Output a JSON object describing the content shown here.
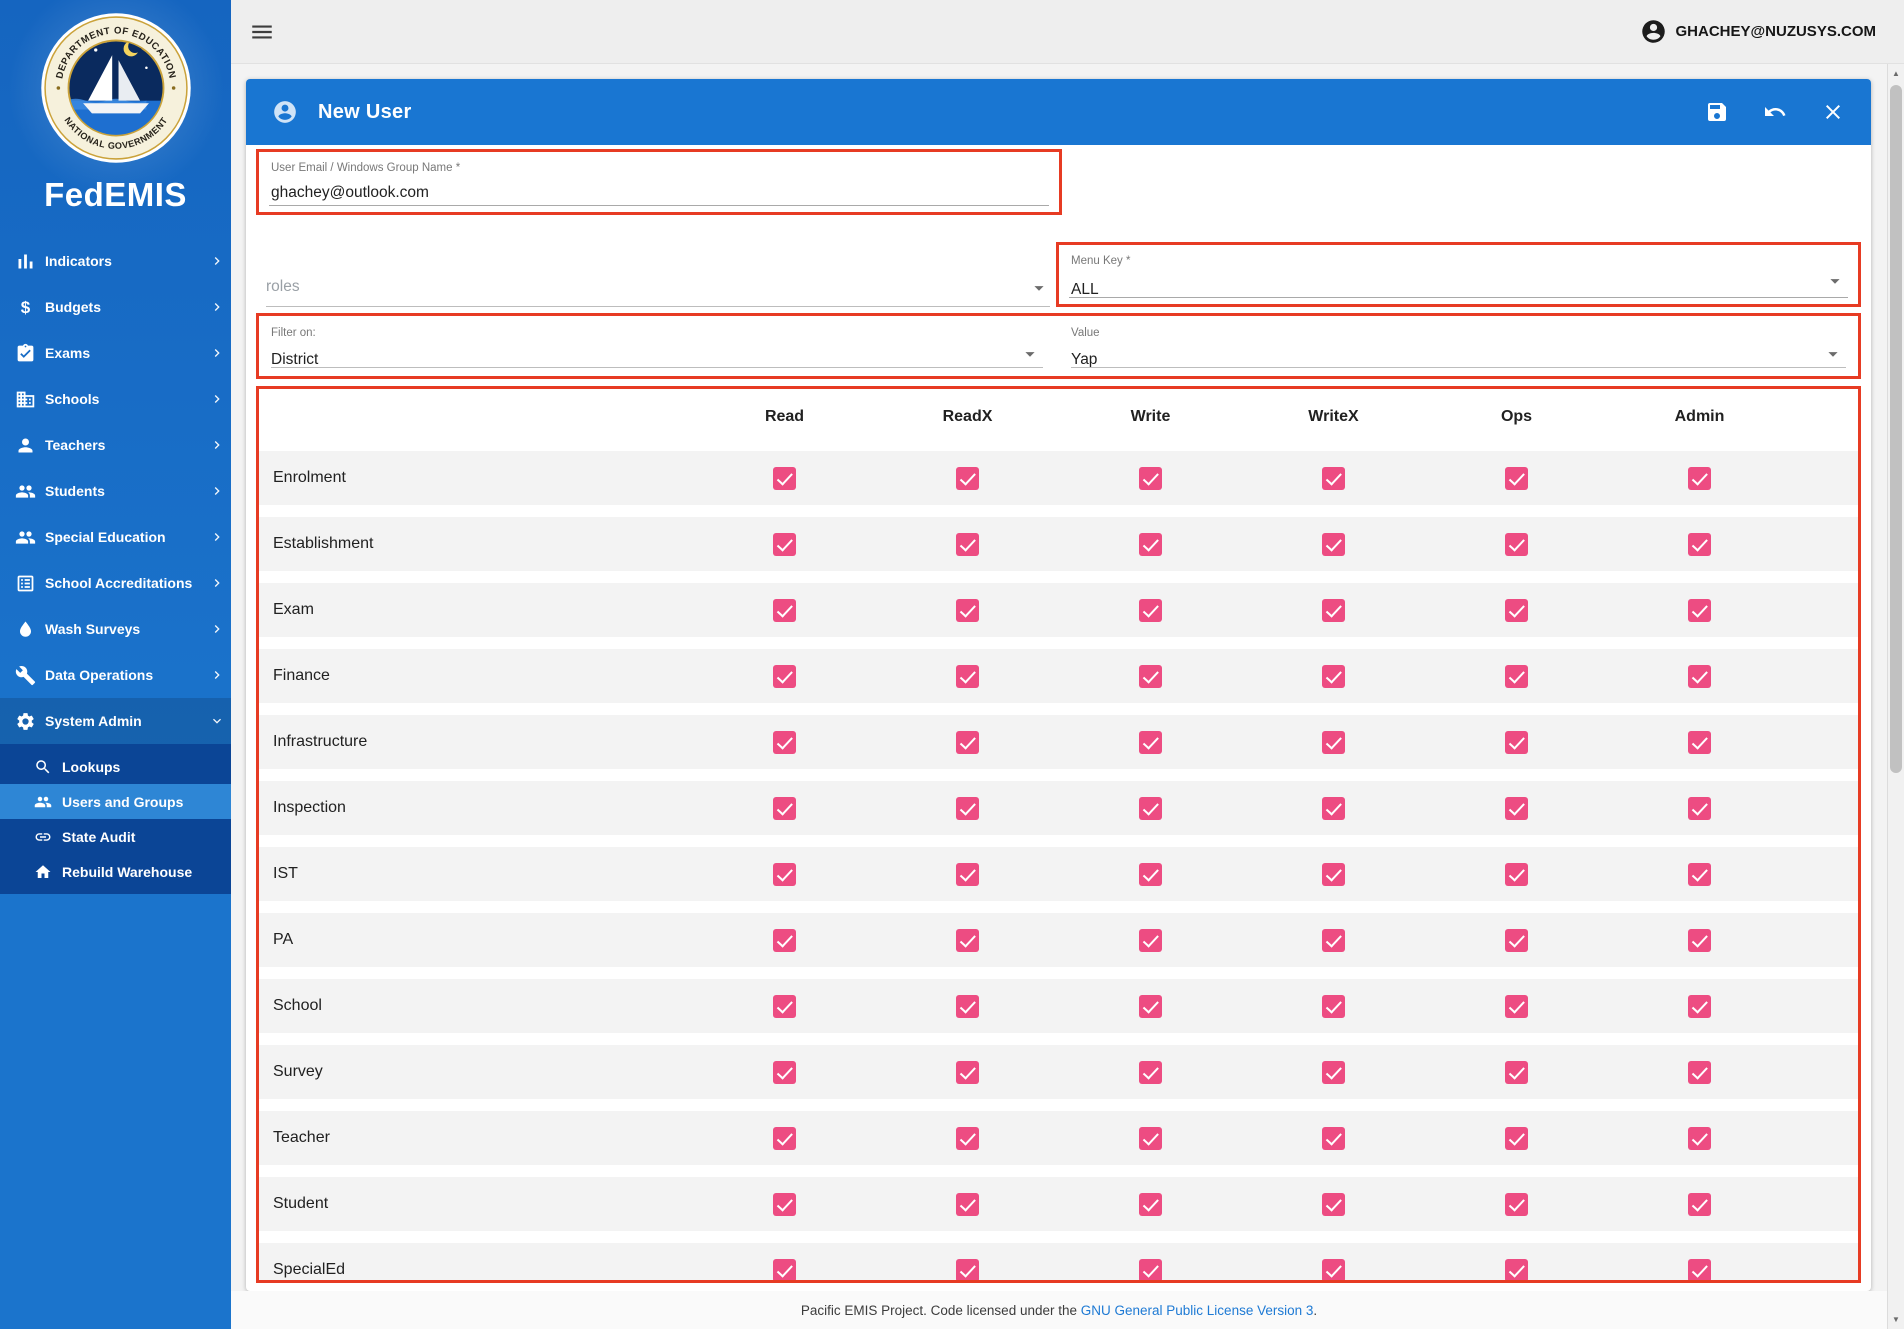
{
  "brand": {
    "title": "FedEMIS",
    "seal_top": "DEPARTMENT OF EDUCATION",
    "seal_bottom": "NATIONAL GOVERNMENT"
  },
  "topbar": {
    "account_email": "GHACHEY@NUZUSYS.COM"
  },
  "icons": {
    "menu": "menu-icon",
    "account": "account-circle-icon",
    "user": "account-circle-icon",
    "save": "save-icon",
    "undo": "undo-icon",
    "close": "close-icon",
    "caret": "caret-down-icon"
  },
  "sidebar": {
    "items": [
      {
        "label": "Indicators",
        "icon": "bar-chart-icon"
      },
      {
        "label": "Budgets",
        "icon": "dollar-icon"
      },
      {
        "label": "Exams",
        "icon": "assignment-icon"
      },
      {
        "label": "Schools",
        "icon": "building-icon"
      },
      {
        "label": "Teachers",
        "icon": "person-icon"
      },
      {
        "label": "Students",
        "icon": "people-icon"
      },
      {
        "label": "Special Education",
        "icon": "people-icon"
      },
      {
        "label": "School Accreditations",
        "icon": "list-card-icon"
      },
      {
        "label": "Wash Surveys",
        "icon": "droplet-icon"
      },
      {
        "label": "Data Operations",
        "icon": "wrench-icon"
      },
      {
        "label": "System Admin",
        "icon": "gear-icon",
        "expanded": true,
        "children": [
          {
            "label": "Lookups",
            "icon": "search-icon"
          },
          {
            "label": "Users and Groups",
            "icon": "people-icon",
            "active": true
          },
          {
            "label": "State Audit",
            "icon": "link-icon"
          },
          {
            "label": "Rebuild Warehouse",
            "icon": "home-icon"
          }
        ]
      }
    ]
  },
  "panel": {
    "title": "New User",
    "email": {
      "label": "User Email / Windows Group Name *",
      "value": "ghachey@outlook.com"
    },
    "roles": {
      "placeholder": "roles"
    },
    "menu_key": {
      "label": "Menu Key *",
      "value": "ALL"
    },
    "filter_on": {
      "label": "Filter on:",
      "value": "District"
    },
    "filter_value": {
      "label": "Value",
      "value": "Yap"
    }
  },
  "permissions": {
    "columns": [
      "Read",
      "ReadX",
      "Write",
      "WriteX",
      "Ops",
      "Admin"
    ],
    "rows": [
      {
        "label": "Enrolment",
        "checks": [
          true,
          true,
          true,
          true,
          true,
          true
        ]
      },
      {
        "label": "Establishment",
        "checks": [
          true,
          true,
          true,
          true,
          true,
          true
        ]
      },
      {
        "label": "Exam",
        "checks": [
          true,
          true,
          true,
          true,
          true,
          true
        ]
      },
      {
        "label": "Finance",
        "checks": [
          true,
          true,
          true,
          true,
          true,
          true
        ]
      },
      {
        "label": "Infrastructure",
        "checks": [
          true,
          true,
          true,
          true,
          true,
          true
        ]
      },
      {
        "label": "Inspection",
        "checks": [
          true,
          true,
          true,
          true,
          true,
          true
        ]
      },
      {
        "label": "IST",
        "checks": [
          true,
          true,
          true,
          true,
          true,
          true
        ]
      },
      {
        "label": "PA",
        "checks": [
          true,
          true,
          true,
          true,
          true,
          true
        ]
      },
      {
        "label": "School",
        "checks": [
          true,
          true,
          true,
          true,
          true,
          true
        ]
      },
      {
        "label": "Survey",
        "checks": [
          true,
          true,
          true,
          true,
          true,
          true
        ]
      },
      {
        "label": "Teacher",
        "checks": [
          true,
          true,
          true,
          true,
          true,
          true
        ]
      },
      {
        "label": "Student",
        "checks": [
          true,
          true,
          true,
          true,
          true,
          true
        ]
      },
      {
        "label": "SpecialEd",
        "checks": [
          true,
          true,
          true,
          true,
          true,
          true
        ]
      }
    ]
  },
  "footer": {
    "text_before": "Pacific EMIS Project. Code licensed under the ",
    "link_text": "GNU General Public License Version 3",
    "text_after": "."
  },
  "colors": {
    "accent_blue": "#1976d2",
    "checkbox_pink": "#ed4c82",
    "annotation_red": "#e73b23",
    "submenu_navy": "#0b4596",
    "active_blue": "#2e86d5"
  }
}
